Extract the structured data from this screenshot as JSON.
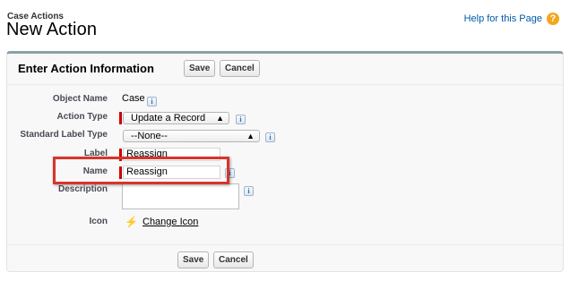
{
  "header": {
    "breadcrumb": "Case Actions",
    "title": "New Action",
    "help_link": "Help for this Page",
    "help_icon": "?"
  },
  "panel": {
    "title": "Enter Action Information",
    "save_label": "Save",
    "cancel_label": "Cancel",
    "accent_color": "#8d9ea7"
  },
  "form": {
    "object_name": {
      "label": "Object Name",
      "value": "Case"
    },
    "action_type": {
      "label": "Action Type",
      "value": "Update a Record"
    },
    "standard_label_type": {
      "label": "Standard Label Type",
      "value": "--None--"
    },
    "label": {
      "label": "Label",
      "value": "Reassign"
    },
    "name": {
      "label": "Name",
      "value": "Reassign"
    },
    "description": {
      "label": "Description",
      "value": ""
    },
    "icon": {
      "label": "Icon",
      "glyph": "⚡",
      "link": "Change Icon"
    },
    "info_glyph": "i",
    "required_color": "#cc0000",
    "highlight_color": "#d9342b"
  },
  "footer": {
    "save_label": "Save",
    "cancel_label": "Cancel"
  }
}
